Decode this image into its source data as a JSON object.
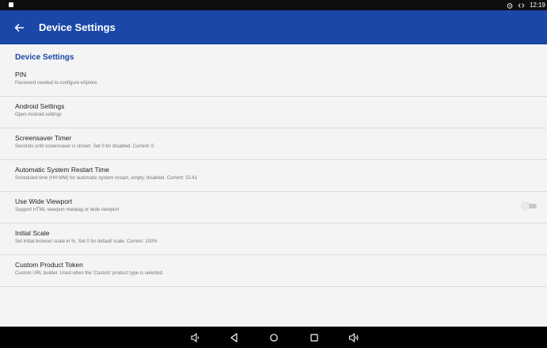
{
  "status_bar": {
    "time": "12:19",
    "icons": [
      "notification-icon",
      "alarm-icon",
      "code-icon"
    ]
  },
  "app_bar": {
    "title": "Device Settings",
    "color": "#1a47a8"
  },
  "section": {
    "header": "Device Settings"
  },
  "preferences": [
    {
      "title": "PIN",
      "summary": "Password needed to configure eXplore"
    },
    {
      "title": "Android Settings",
      "summary": "Open Android settings"
    },
    {
      "title": "Screensaver Timer",
      "summary": "Seconds until screensaver is shown. Set 0 for disabled. Current: 0"
    },
    {
      "title": "Automatic System Restart Time",
      "summary": "Scheduled time (HH:MM) for automatic system restart, empty: disabled. Current: 15:41"
    },
    {
      "title": "Use Wide Viewport",
      "summary": "Support HTML viewport metatag or wide viewport",
      "toggle": "off"
    },
    {
      "title": "Initial Scale",
      "summary": "Set initial browser scale in %. Set 0 for default scale. Current: 100%"
    },
    {
      "title": "Custom Product Token",
      "summary": "Custom URL builder. Used when the 'Custom' product type is selected"
    }
  ],
  "nav_bar": {
    "buttons": [
      "volume-down-icon",
      "back-icon",
      "home-icon",
      "recents-icon",
      "volume-up-icon"
    ]
  }
}
